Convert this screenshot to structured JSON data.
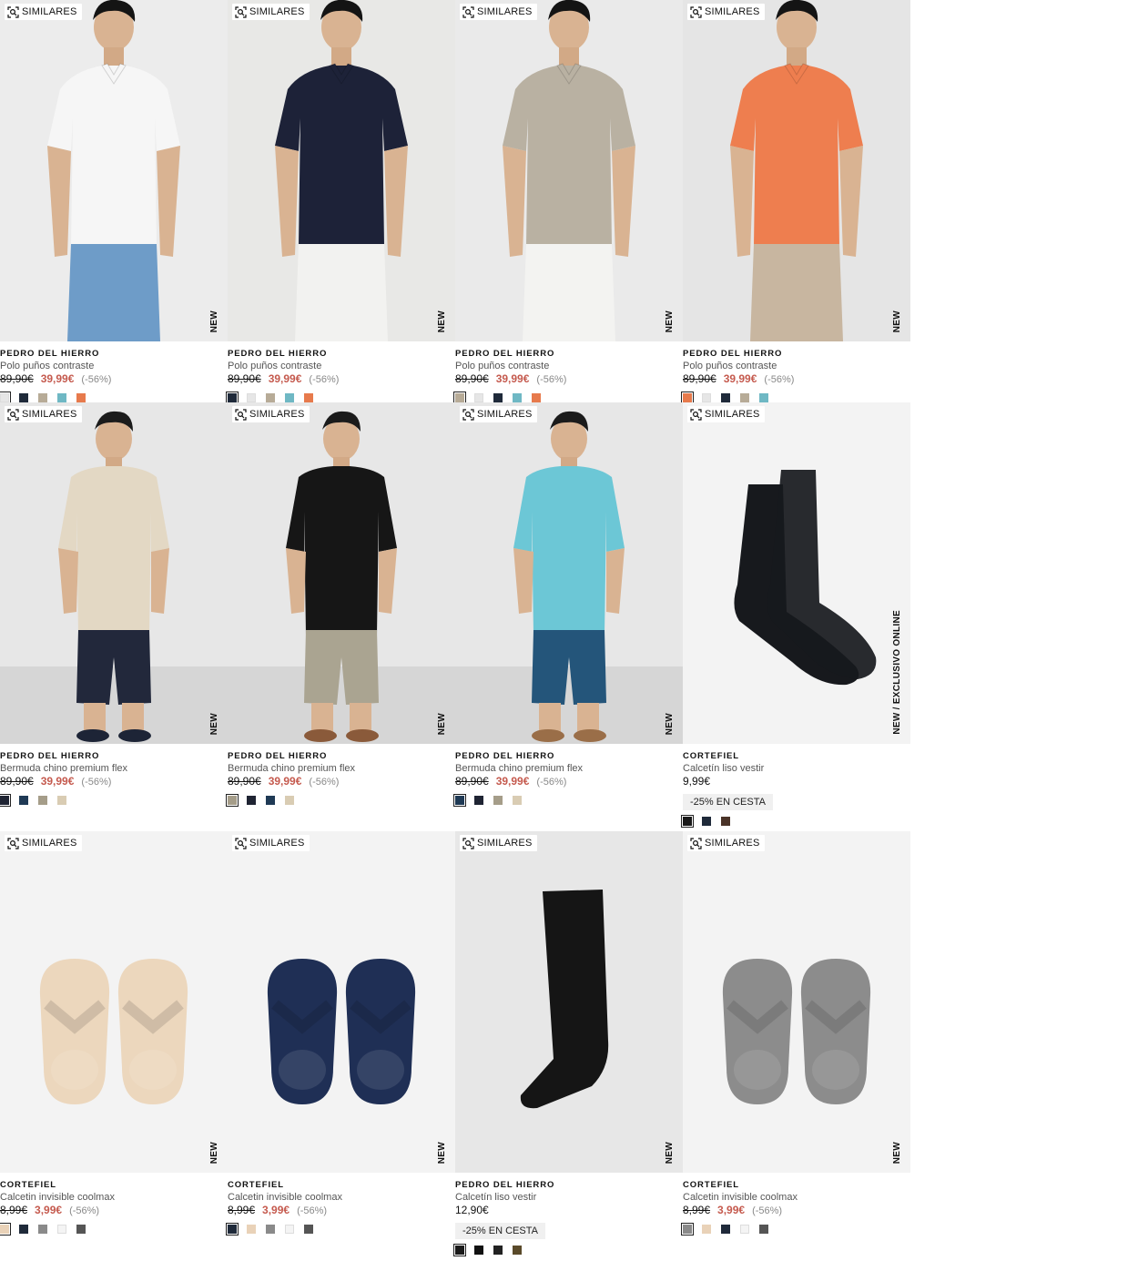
{
  "similar_label": "SIMILARES",
  "products": [
    {
      "brand": "PEDRO DEL HIERRO",
      "name": "Polo puños contraste",
      "old_price": "89,90€",
      "price": "39,99€",
      "discount": "(-56%)",
      "tag": "NEW",
      "swatches": [
        "#e6e6e6",
        "#1f2a3a",
        "#b7ab97",
        "#6fb8c4",
        "#e77a4c"
      ],
      "photo": "polo-white"
    },
    {
      "brand": "PEDRO DEL HIERRO",
      "name": "Polo puños contraste",
      "old_price": "89,90€",
      "price": "39,99€",
      "discount": "(-56%)",
      "tag": "NEW",
      "swatches": [
        "#1f2a3a",
        "#e6e6e6",
        "#b7ab97",
        "#6fb8c4",
        "#e77a4c"
      ],
      "photo": "polo-navy"
    },
    {
      "brand": "PEDRO DEL HIERRO",
      "name": "Polo puños contraste",
      "old_price": "89,90€",
      "price": "39,99€",
      "discount": "(-56%)",
      "tag": "NEW",
      "swatches": [
        "#b7ab97",
        "#e6e6e6",
        "#1f2a3a",
        "#6fb8c4",
        "#e77a4c"
      ],
      "photo": "polo-beige"
    },
    {
      "brand": "PEDRO DEL HIERRO",
      "name": "Polo puños contraste",
      "old_price": "89,90€",
      "price": "39,99€",
      "discount": "(-56%)",
      "tag": "NEW",
      "swatches": [
        "#e77a4c",
        "#e6e6e6",
        "#1f2a3a",
        "#b7ab97",
        "#6fb8c4"
      ],
      "photo": "polo-orange"
    },
    {
      "brand": "PEDRO DEL HIERRO",
      "name": "Bermuda chino premium flex",
      "old_price": "89,90€",
      "price": "39,99€",
      "discount": "(-56%)",
      "tag": "NEW",
      "swatches": [
        "#1f2433",
        "#1f3a55",
        "#a59d89",
        "#d9ccb3"
      ],
      "photo": "bermuda-navy"
    },
    {
      "brand": "PEDRO DEL HIERRO",
      "name": "Bermuda chino premium flex",
      "old_price": "89,90€",
      "price": "39,99€",
      "discount": "(-56%)",
      "tag": "NEW",
      "swatches": [
        "#a59d89",
        "#1f2433",
        "#1f3a55",
        "#d9ccb3"
      ],
      "photo": "bermuda-khaki"
    },
    {
      "brand": "PEDRO DEL HIERRO",
      "name": "Bermuda chino premium flex",
      "old_price": "89,90€",
      "price": "39,99€",
      "discount": "(-56%)",
      "tag": "NEW",
      "swatches": [
        "#1f3a55",
        "#1f2433",
        "#a59d89",
        "#d9ccb3"
      ],
      "photo": "bermuda-blue"
    },
    {
      "brand": "CORTEFIEL",
      "name": "Calcetín liso vestir",
      "old_price": "",
      "price": "9,99€",
      "discount": "",
      "tag": "NEW  /  EXCLUSIVO ONLINE",
      "promo": "-25% EN CESTA",
      "swatches": [
        "#1a1a1a",
        "#1f2a3a",
        "#4a3328"
      ],
      "photo": "sock-black"
    },
    {
      "brand": "CORTEFIEL",
      "name": "Calcetin invisible coolmax",
      "old_price": "8,99€",
      "price": "3,99€",
      "discount": "(-56%)",
      "tag": "NEW",
      "swatches": [
        "#e9d2b8",
        "#1f2a3a",
        "#8a8a8a",
        "#f4f4f4",
        "#555555"
      ],
      "photo": "nsock-beige"
    },
    {
      "brand": "CORTEFIEL",
      "name": "Calcetin invisible coolmax",
      "old_price": "8,99€",
      "price": "3,99€",
      "discount": "(-56%)",
      "tag": "NEW",
      "swatches": [
        "#1f2a3a",
        "#e9d2b8",
        "#8a8a8a",
        "#f4f4f4",
        "#555555"
      ],
      "photo": "nsock-navy"
    },
    {
      "brand": "PEDRO DEL HIERRO",
      "name": "Calcetín liso vestir",
      "old_price": "",
      "price": "12,90€",
      "discount": "",
      "tag": "NEW",
      "promo": "-25% EN CESTA",
      "swatches": [
        "#1a1a1a",
        "#111111",
        "#222222",
        "#5a4a2a"
      ],
      "photo": "sock-long"
    },
    {
      "brand": "CORTEFIEL",
      "name": "Calcetin invisible coolmax",
      "old_price": "8,99€",
      "price": "3,99€",
      "discount": "(-56%)",
      "tag": "NEW",
      "swatches": [
        "#8a8a8a",
        "#e9d2b8",
        "#1f2a3a",
        "#f4f4f4",
        "#555555"
      ],
      "photo": "nsock-grey"
    }
  ]
}
